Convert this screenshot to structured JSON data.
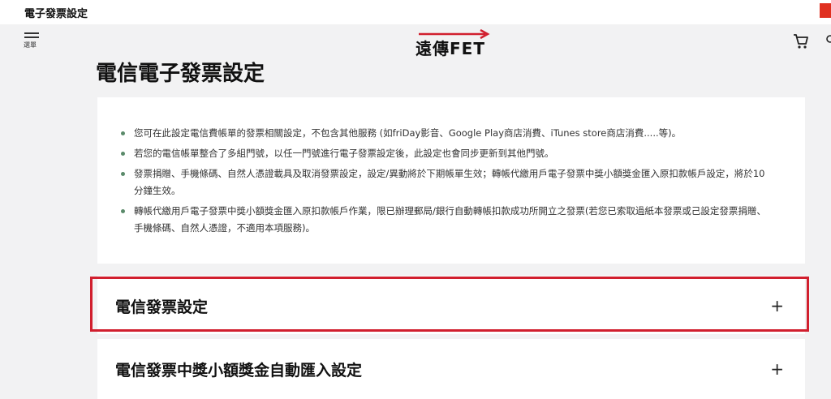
{
  "window": {
    "title": "電子發票設定"
  },
  "header": {
    "menu_label": "選單",
    "logo_text": "遠傳FET",
    "colors": {
      "brand_red": "#d11f2e"
    }
  },
  "page": {
    "title": "電信電子發票設定"
  },
  "notes": [
    "您可在此設定電信費帳單的發票相關設定，不包含其他服務 (如friDay影音、Google Play商店消費、iTunes store商店消費.....等)。",
    "若您的電信帳單整合了多組門號，以任一門號進行電子發票設定後，此設定也會同步更新到其他門號。",
    "發票捐贈、手機條碼、自然人憑證載具及取消發票設定，設定/異動將於下期帳單生效；轉帳代繳用戶電子發票中獎小額獎金匯入原扣款帳戶設定，將於10分鐘生效。",
    "轉帳代繳用戶電子發票中獎小額獎金匯入原扣款帳戶作業，限已辦理郵局/銀行自動轉帳扣款成功所開立之發票(若您已索取過紙本發票或己設定發票捐贈、手機條碼、自然人憑證，不適用本項服務)。"
  ],
  "accordion": [
    {
      "title": "電信發票設定",
      "icon": "+"
    },
    {
      "title": "電信發票中獎小額獎金自動匯入設定",
      "icon": "+"
    }
  ]
}
